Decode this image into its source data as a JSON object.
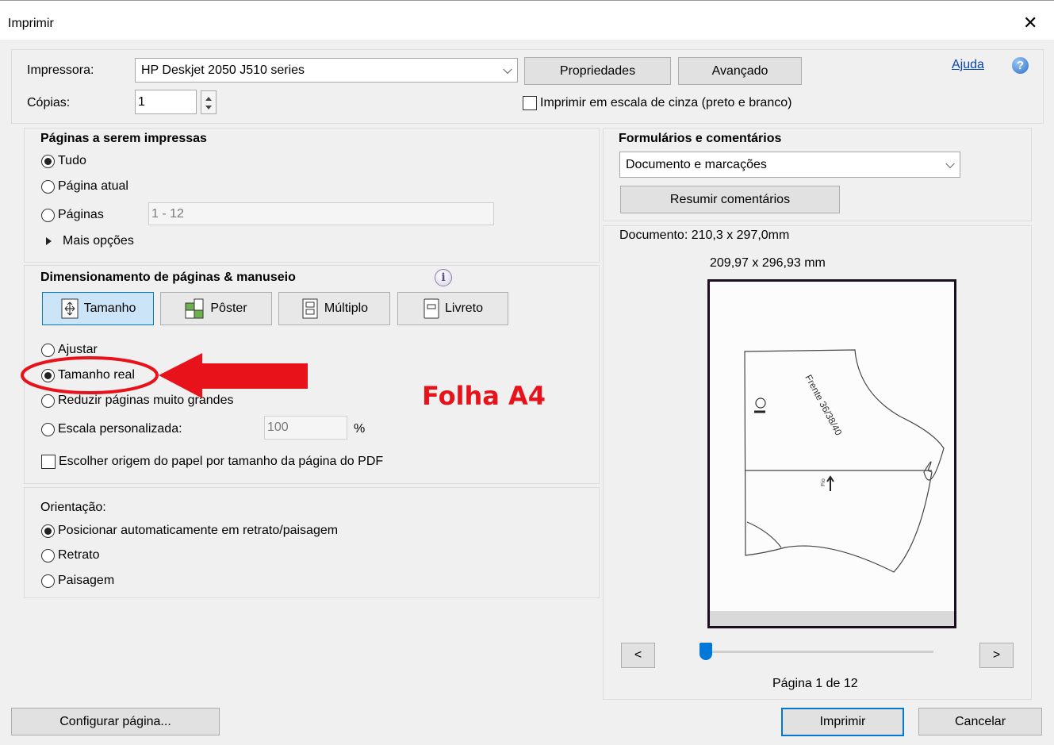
{
  "window": {
    "title": "Imprimir",
    "close_glyph": "✕"
  },
  "header": {
    "printer_label": "Impressora:",
    "printer_value": "HP Deskjet 2050 J510 series",
    "properties_button": "Propriedades",
    "advanced_button": "Avançado",
    "help_link": "Ajuda",
    "help_icon_glyph": "?",
    "copies_label": "Cópias:",
    "copies_value": "1",
    "grayscale_label": "Imprimir em escala de cinza (preto e branco)"
  },
  "pages_section": {
    "title": "Páginas a serem impressas",
    "options": [
      "Tudo",
      "Página atual",
      "Páginas"
    ],
    "selected": "Tudo",
    "range_value": "1 - 12",
    "more_options": "Mais opções"
  },
  "sizing_section": {
    "title": "Dimensionamento de páginas & manuseio",
    "modes": [
      "Tamanho",
      "Pôster",
      "Múltiplo",
      "Livreto"
    ],
    "active_mode": "Tamanho",
    "options": {
      "fit": "Ajustar",
      "actual": "Tamanho real",
      "shrink": "Reduzir páginas muito grandes",
      "custom": "Escala personalizada:"
    },
    "selected": "Tamanho real",
    "custom_scale_value": "100",
    "percent_sign": "%",
    "paper_source_label": "Escolher origem do papel por tamanho da página do PDF"
  },
  "orientation_section": {
    "title": "Orientação:",
    "options": [
      "Posicionar automaticamente em retrato/paisagem",
      "Retrato",
      "Paisagem"
    ],
    "selected": "Posicionar automaticamente em retrato/paisagem"
  },
  "forms_section": {
    "title": "Formulários e comentários",
    "dropdown_value": "Documento e marcações",
    "summarize_button": "Resumir comentários"
  },
  "preview": {
    "document_size": "Documento: 210,3 x 297,0mm",
    "page_size": "209,97 x 296,93 mm",
    "prev_button": "<",
    "next_button": ">",
    "page_indicator": "Página 1 de 12",
    "page_position_fraction": 0.0,
    "pattern_label": "Frente 36/38/40",
    "grain_label": "Fio"
  },
  "footer": {
    "page_setup_button": "Configurar página...",
    "print_button": "Imprimir",
    "cancel_button": "Cancelar"
  },
  "annotation": {
    "text": "Folha A4",
    "color": "#e8121b"
  },
  "colors": {
    "accent": "#0078d7",
    "dialog_bg": "#f0f0f0",
    "annotation_red": "#e8121b"
  }
}
